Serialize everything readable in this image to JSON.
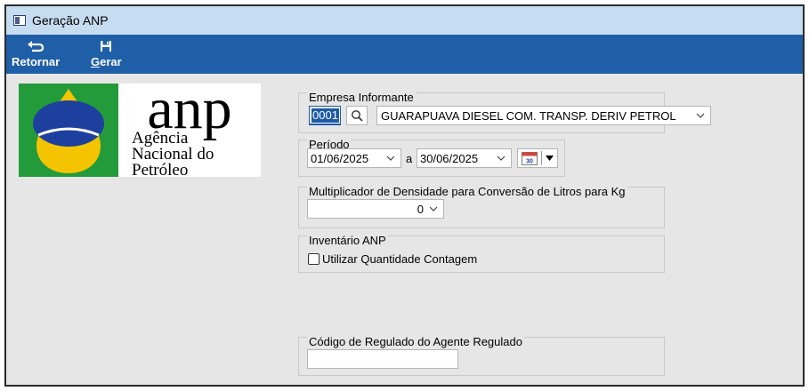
{
  "window": {
    "title": "Geração ANP"
  },
  "toolbar": {
    "back_label_prefix": "Retornar",
    "generate_key": "G",
    "generate_rest": "erar"
  },
  "logo": {
    "acronym": "anp",
    "line1": "Agência",
    "line2": "Nacional do",
    "line3": "Petróleo",
    "colors": {
      "green": "#239b3a",
      "blue": "#1d3f9e",
      "yellow": "#f5c400"
    }
  },
  "empresa": {
    "label": "Empresa Informante",
    "code": "0001",
    "name": "GUARAPUAVA DIESEL COM. TRANSP. DERIV PETROL"
  },
  "periodo": {
    "label": "Período",
    "start": "01/06/2025",
    "separator": "a",
    "end": "30/06/2025",
    "calendar_day": "30"
  },
  "densidade": {
    "label": "Multiplicador de Densidade para Conversão de Litros para Kg",
    "value": "0"
  },
  "inventario": {
    "label": "Inventário ANP",
    "checkbox_label": "Utilizar Quantidade Contagem",
    "checked": false
  },
  "codigo": {
    "label": "Código de Regulado do Agente Regulado",
    "value": ""
  },
  "colors": {
    "toolbar": "#1f5fa8",
    "titlebar": "#c6dcf0",
    "panel": "#e6e6e6",
    "selection": "#1e5aa8"
  }
}
